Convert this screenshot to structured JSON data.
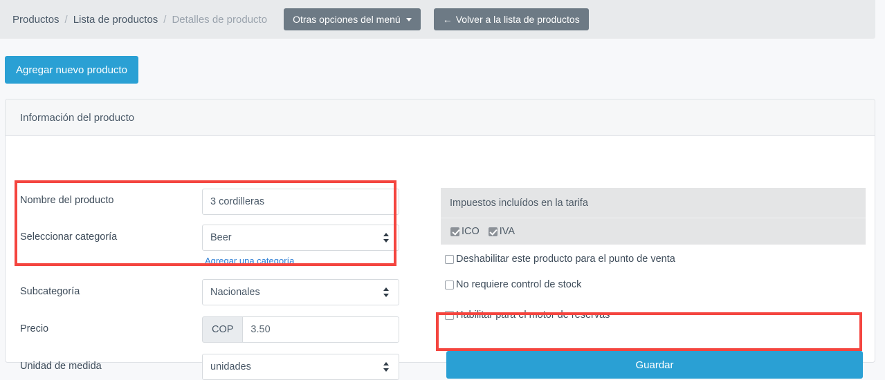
{
  "topbar": {
    "breadcrumb": [
      {
        "label": "Productos",
        "active": false
      },
      {
        "label": "Lista de productos",
        "active": false
      },
      {
        "label": "Detalles de producto",
        "active": true
      }
    ],
    "separator": "/",
    "menu_button_label": "Otras opciones del menú",
    "back_button_label": "Volver a la lista de productos",
    "back_icon": "arrow-left-icon",
    "caret_icon": "caret-down-icon"
  },
  "actions": {
    "add_product_label": "Agregar nuevo producto"
  },
  "card": {
    "header_title": "Información del producto"
  },
  "form": {
    "product_name": {
      "label": "Nombre del producto",
      "value": "3 cordilleras",
      "placeholder": "Nombre del producto"
    },
    "category": {
      "label": "Seleccionar categoría",
      "value": "Beer",
      "add_link": "Agregar una categoría"
    },
    "subcategory": {
      "label": "Subcategoría",
      "value": "Nacionales"
    },
    "price": {
      "label": "Precio",
      "currency": "COP",
      "value": "3.50",
      "placeholder": "0.00"
    },
    "unit": {
      "label": "Unidad de medida",
      "value": "unidades"
    }
  },
  "taxes": {
    "panel_title": "Impuestos incluídos en la tarifa",
    "items": [
      {
        "label": "ICO",
        "checked": true
      },
      {
        "label": "IVA",
        "checked": true
      }
    ]
  },
  "options": [
    {
      "label": "Deshabilitar este producto para el punto de venta",
      "checked": false
    },
    {
      "label": "No requiere control de stock",
      "checked": false
    },
    {
      "label": "Habilitar para el motor de reservas",
      "checked": false
    }
  ],
  "save": {
    "label": "Guardar"
  },
  "colors": {
    "primary": "#2aa0d4",
    "topbar_bg": "#e8eaec",
    "gray_button": "#6d7a85",
    "link": "#2f7fd4",
    "annotation": "#f4453f",
    "page_bg": "#f7f8fa",
    "panel_gray": "#e4e5e6"
  }
}
